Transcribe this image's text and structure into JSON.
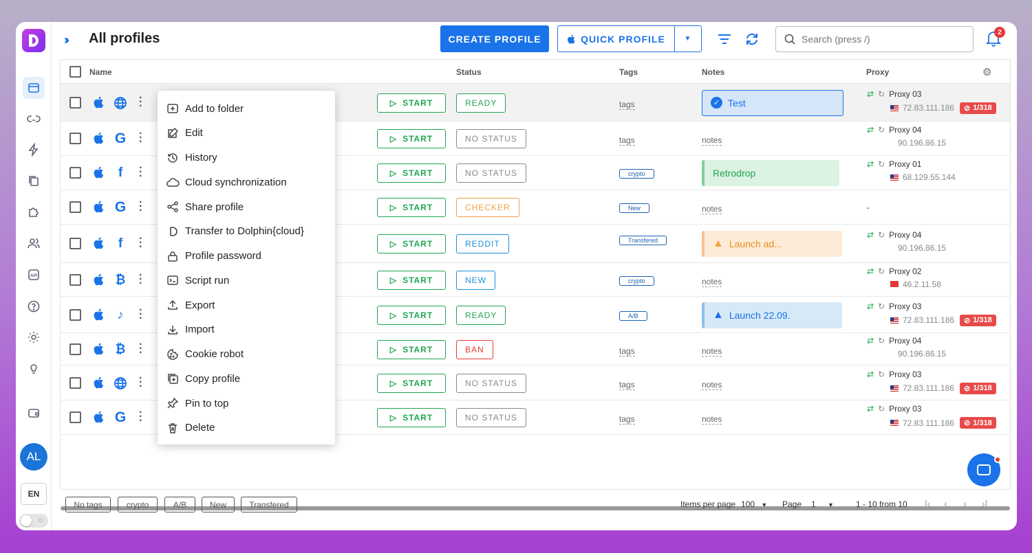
{
  "app": {
    "title": "All profiles"
  },
  "colors": {
    "accent": "#1a73e8",
    "green": "#1ca64e",
    "red": "#e53935",
    "orange": "#f0a040"
  },
  "sidebar": {
    "items": [
      {
        "name": "browser-profiles",
        "icon": "window-icon"
      },
      {
        "name": "links",
        "icon": "link-icon"
      },
      {
        "name": "automation",
        "icon": "bolt-icon"
      },
      {
        "name": "copy",
        "icon": "copy-icon"
      },
      {
        "name": "extensions",
        "icon": "puzzle-icon"
      },
      {
        "name": "team",
        "icon": "users-icon"
      },
      {
        "name": "api",
        "icon": "api-icon"
      },
      {
        "name": "help",
        "icon": "help-icon"
      },
      {
        "name": "settings",
        "icon": "gear-icon"
      },
      {
        "name": "tips",
        "icon": "bulb-icon"
      },
      {
        "name": "wallet",
        "icon": "wallet-icon"
      }
    ],
    "avatar": "AL",
    "lang": "EN"
  },
  "header": {
    "create_label": "CREATE PROFILE",
    "quick_label": "QUICK PROFILE",
    "search_placeholder": "Search (press /)",
    "notifications": "2"
  },
  "columns": {
    "name": "Name",
    "status": "Status",
    "tags": "Tags",
    "notes": "Notes",
    "proxy": "Proxy"
  },
  "start_label": "START",
  "rows": [
    {
      "site": "globe",
      "status": "READY",
      "status_color": "#1ca64e",
      "tags": "tags",
      "tag_chip": "",
      "notes": "",
      "note": {
        "text": "Test",
        "kind": "blue-check"
      },
      "proxy": "Proxy 03",
      "ip": "72.83.111.186",
      "flag": "us",
      "ban": "1/318"
    },
    {
      "site": "G",
      "status": "NO STATUS",
      "status_color": "#888888",
      "tags": "tags",
      "tag_chip": "",
      "notes": "notes",
      "note": null,
      "proxy": "Proxy 04",
      "ip": "90.196.86.15",
      "flag": "",
      "ban": ""
    },
    {
      "site": "f",
      "status": "NO STATUS",
      "status_color": "#888888",
      "tags": "",
      "tag_chip": "crypto",
      "notes": "",
      "note": {
        "text": "Retrodrop",
        "kind": "green"
      },
      "proxy": "Proxy 01",
      "ip": "68.129.55.144",
      "flag": "us",
      "ban": ""
    },
    {
      "site": "G",
      "status": "CHECKER",
      "status_color": "#f0a040",
      "tags": "",
      "tag_chip": "New",
      "notes": "notes",
      "note": null,
      "proxy": "-",
      "ip": "",
      "flag": "",
      "ban": ""
    },
    {
      "site": "f",
      "status": "REDDIT",
      "status_color": "#1a8fd8",
      "tags": "",
      "tag_chip": "Transfered",
      "notes": "",
      "note": {
        "text": "Launch ad...",
        "kind": "orange-warn"
      },
      "proxy": "Proxy 04",
      "ip": "90.196.86.15",
      "flag": "",
      "ban": ""
    },
    {
      "site": "B",
      "status": "NEW",
      "status_color": "#1a8fd8",
      "tags": "",
      "tag_chip": "crypto",
      "notes": "notes",
      "note": null,
      "proxy": "Proxy 02",
      "ip": "46.2.11.58",
      "flag": "tr",
      "ban": ""
    },
    {
      "site": "tiktok",
      "status": "READY",
      "status_color": "#1ca64e",
      "tags": "",
      "tag_chip": "A/B",
      "notes": "",
      "note": {
        "text": "Launch 22.09.",
        "kind": "blue-warn"
      },
      "proxy": "Proxy 03",
      "ip": "72.83.111.186",
      "flag": "us",
      "ban": "1/318"
    },
    {
      "site": "B",
      "status": "BAN",
      "status_color": "#e53935",
      "tags": "tags",
      "tag_chip": "",
      "notes": "notes",
      "note": null,
      "proxy": "Proxy 04",
      "ip": "90.196.86.15",
      "flag": "",
      "ban": ""
    },
    {
      "site": "globe",
      "status": "NO STATUS",
      "status_color": "#888888",
      "tags": "tags",
      "tag_chip": "",
      "notes": "notes",
      "note": null,
      "proxy": "Proxy 03",
      "ip": "72.83.111.186",
      "flag": "us",
      "ban": "1/318"
    },
    {
      "site": "G",
      "status": "NO STATUS",
      "status_color": "#888888",
      "tags": "tags",
      "tag_chip": "",
      "notes": "notes",
      "note": null,
      "proxy": "Proxy 03",
      "ip": "72.83.111.186",
      "flag": "us",
      "ban": "1/318"
    }
  ],
  "context_menu": [
    {
      "label": "Add to folder",
      "icon": "folder-plus-icon"
    },
    {
      "label": "Edit",
      "icon": "edit-icon"
    },
    {
      "label": "History",
      "icon": "history-icon"
    },
    {
      "label": "Cloud synchronization",
      "icon": "cloud-icon"
    },
    {
      "label": "Share profile",
      "icon": "share-icon"
    },
    {
      "label": "Transfer to Dolphin{cloud}",
      "icon": "transfer-icon"
    },
    {
      "label": "Profile password",
      "icon": "lock-icon"
    },
    {
      "label": "Script run",
      "icon": "terminal-icon"
    },
    {
      "label": "Export",
      "icon": "upload-icon"
    },
    {
      "label": "Import",
      "icon": "download-icon"
    },
    {
      "label": "Cookie robot",
      "icon": "cookie-icon"
    },
    {
      "label": "Copy profile",
      "icon": "copy-icon"
    },
    {
      "label": "Pin to top",
      "icon": "pin-icon"
    },
    {
      "label": "Delete",
      "icon": "trash-icon"
    }
  ],
  "footer": {
    "tag_filters": [
      "No tags",
      "crypto",
      "A/B",
      "New",
      "Transfered"
    ],
    "items_per_page_label": "Items per page",
    "items_per_page": "100",
    "page_label": "Page",
    "page": "1",
    "range": "1 - 10 from 10"
  }
}
